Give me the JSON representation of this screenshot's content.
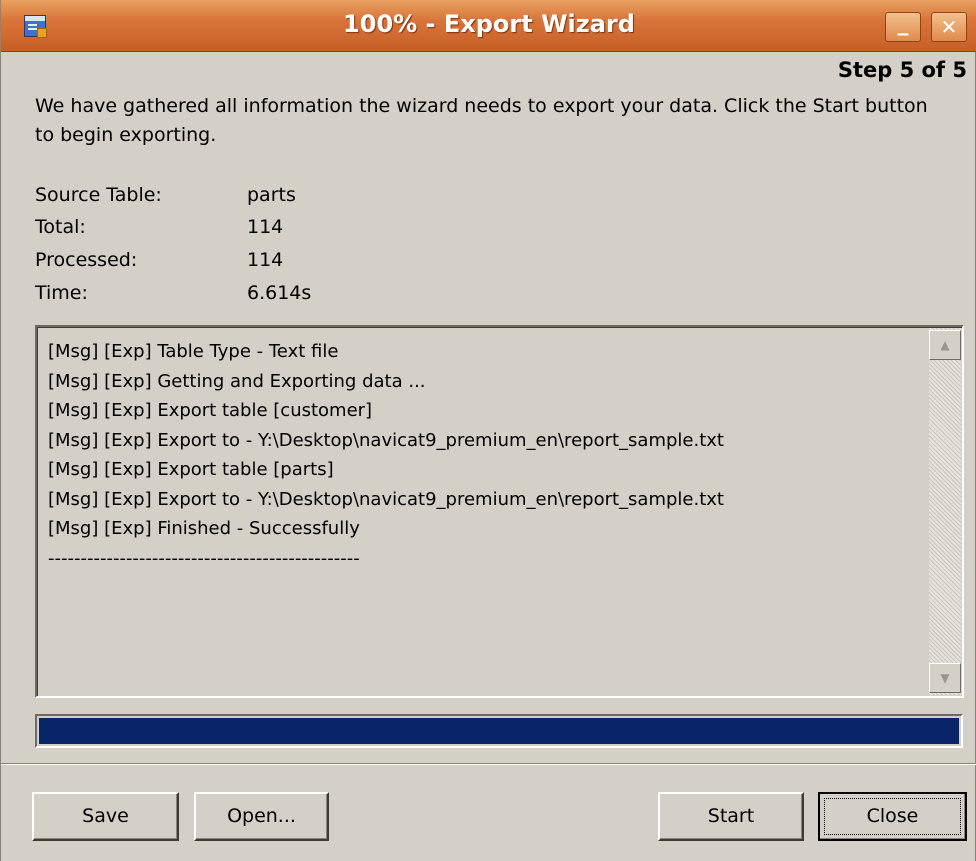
{
  "window": {
    "title": "100% - Export Wizard",
    "minimize_label": "_",
    "close_label": "✕"
  },
  "header": {
    "step": "Step 5 of 5",
    "intro": "We have gathered all information the wizard needs to export your data. Click the Start button to begin exporting."
  },
  "info": [
    {
      "label": "Source Table:",
      "value": "parts"
    },
    {
      "label": "Total:",
      "value": "114"
    },
    {
      "label": "Processed:",
      "value": "114"
    },
    {
      "label": "Time:",
      "value": "6.614s"
    }
  ],
  "log": [
    "[Msg] [Exp] Table Type - Text file",
    "[Msg] [Exp] Getting and Exporting data ...",
    "[Msg] [Exp] Export table [customer]",
    "[Msg] [Exp] Export to - Y:\\Desktop\\navicat9_premium_en\\report_sample.txt",
    "[Msg] [Exp] Export table [parts]",
    "[Msg] [Exp] Export to - Y:\\Desktop\\navicat9_premium_en\\report_sample.txt",
    "[Msg] [Exp] Finished - Successfully",
    "------------------------------------------------"
  ],
  "progress": {
    "percent": 100,
    "fill_color": "#0a246a"
  },
  "buttons": {
    "save": "Save",
    "open": "Open...",
    "start": "Start",
    "close": "Close"
  },
  "colors": {
    "titlebar": "#d8743a",
    "window_bg": "#d4d0c8"
  },
  "icons": {
    "app": "export-wizard-app-icon",
    "scroll_up": "scroll-up-arrow-icon",
    "scroll_down": "scroll-down-arrow-icon"
  }
}
